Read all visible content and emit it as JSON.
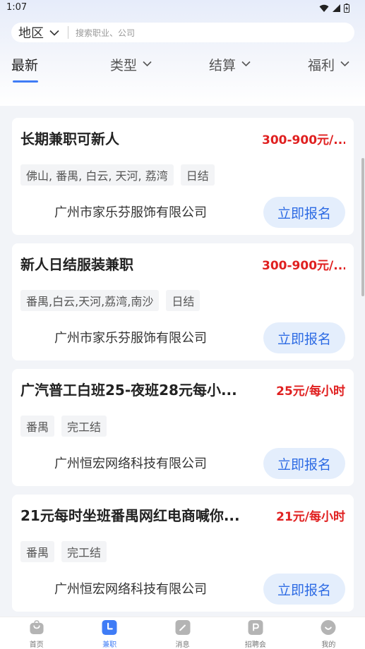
{
  "status_bar": {
    "time": "1:07"
  },
  "search": {
    "region_label": "地区",
    "placeholder": "搜索职业、公司"
  },
  "filter_tabs": [
    {
      "label": "最新",
      "active": true
    },
    {
      "label": "类型"
    },
    {
      "label": "结算"
    },
    {
      "label": "福利"
    }
  ],
  "jobs": [
    {
      "title": "长期兼职可新人",
      "salary": "300-900元/...",
      "tags": [
        "佛山, 番禺, 白云, 天河, 荔湾",
        "日结"
      ],
      "company": "广州市家乐芬服饰有限公司",
      "apply_label": "立即报名"
    },
    {
      "title": "新人日结服装兼职",
      "salary": "300-900元/...",
      "tags": [
        "番禺,白云,天河,荔湾,南沙",
        "日结"
      ],
      "company": "广州市家乐芬服饰有限公司",
      "apply_label": "立即报名"
    },
    {
      "title": "广汽普工白班25-夜班28元每小...",
      "salary": "25元/每小时",
      "tags": [
        "番禺",
        "完工结"
      ],
      "company": "广州恒宏网络科技有限公司",
      "apply_label": "立即报名"
    },
    {
      "title": "21元每时坐班番禺网红电商喊你...",
      "salary": "21元/每小时",
      "tags": [
        "番禺",
        "完工结"
      ],
      "company": "广州恒宏网络科技有限公司",
      "apply_label": "立即报名"
    }
  ],
  "bottom_nav": [
    {
      "label": "首页",
      "icon": "home-bag-icon"
    },
    {
      "label": "兼职",
      "icon": "clock-icon",
      "active": true
    },
    {
      "label": "消息",
      "icon": "message-edit-icon"
    },
    {
      "label": "招聘会",
      "icon": "job-fair-icon"
    },
    {
      "label": "我的",
      "icon": "profile-smile-icon"
    }
  ],
  "colors": {
    "accent": "#3f7cf6",
    "salary": "#e02020",
    "apply_bg": "#e4eefc",
    "apply_text": "#2d6be4"
  }
}
